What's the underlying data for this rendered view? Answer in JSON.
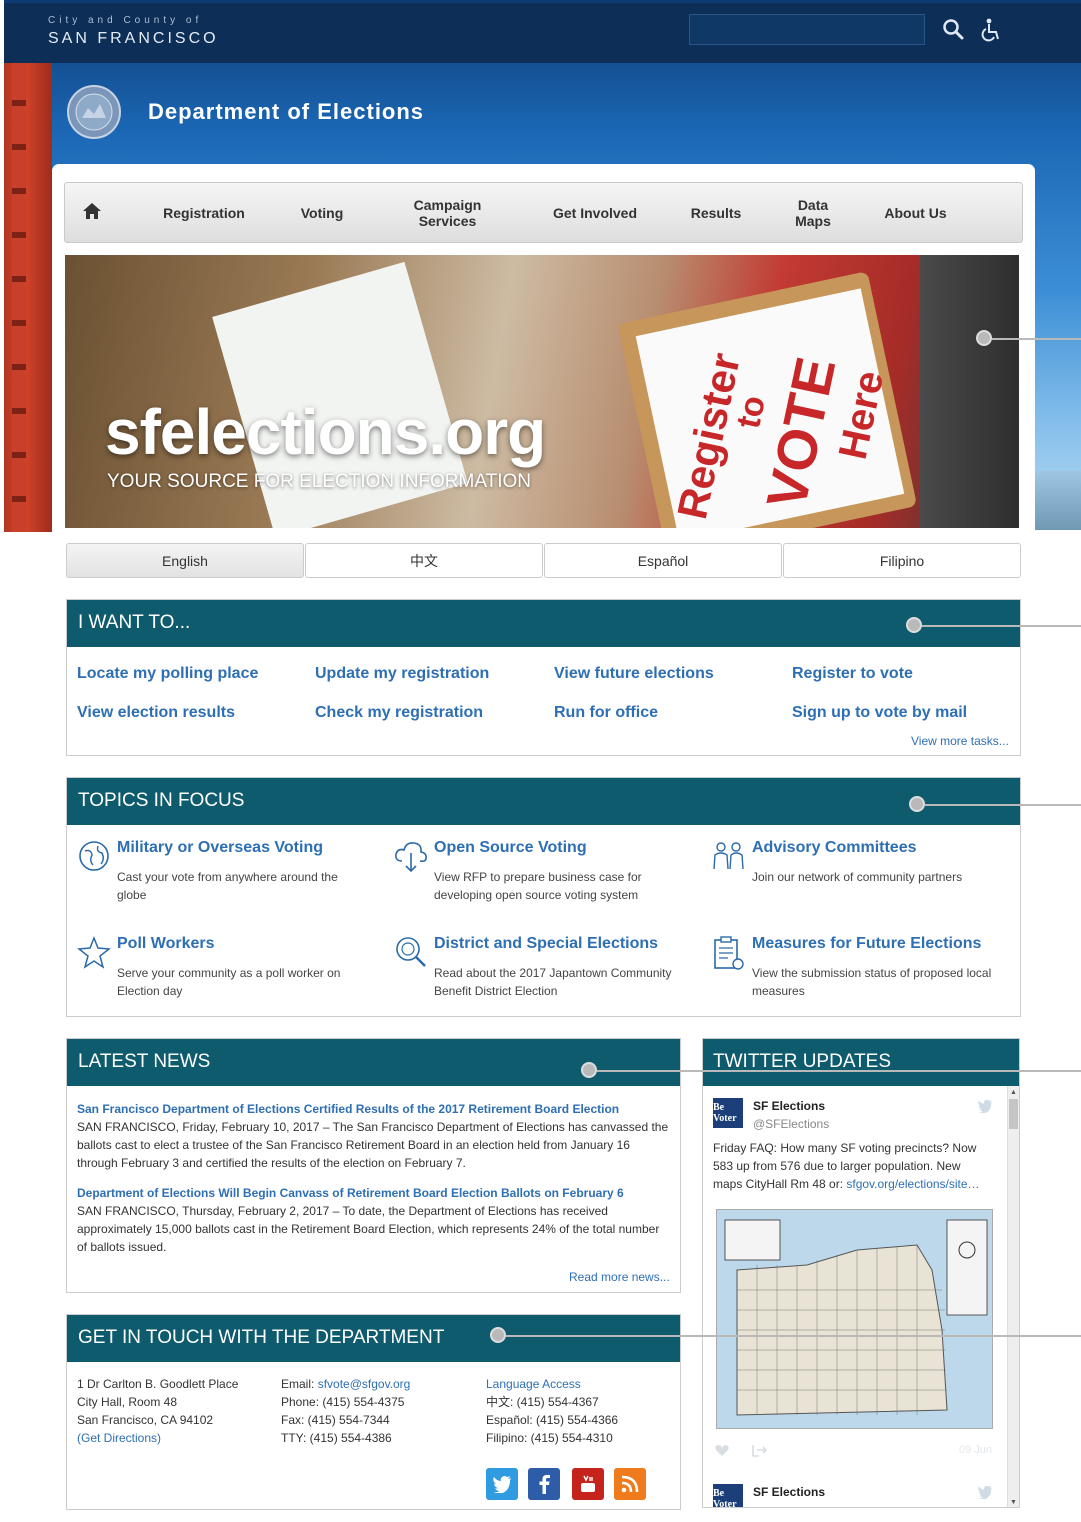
{
  "header": {
    "brand_small": "City and County of",
    "brand_big": "SAN FRANCISCO",
    "search_placeholder": "",
    "department_title": "Department of Elections"
  },
  "nav": {
    "items": [
      {
        "label": "Registration"
      },
      {
        "label": "Voting"
      },
      {
        "label": "Campaign Services"
      },
      {
        "label": "Get Involved"
      },
      {
        "label": "Results"
      },
      {
        "label": "Data Maps"
      },
      {
        "label": "About Us"
      }
    ]
  },
  "hero": {
    "brand": "sfelections.org",
    "tagline": "YOUR SOURCE FOR ELECTION INFORMATION",
    "sign_line1": "Register",
    "sign_line2": "to",
    "sign_line3": "VOTE",
    "sign_line4": "Here"
  },
  "languages": [
    "English",
    "中文",
    "Español",
    "Filipino"
  ],
  "i_want_to": {
    "title": "I WANT TO...",
    "tasks": [
      "Locate my polling place",
      "Update my registration",
      "View future elections",
      "Register to vote",
      "View election results",
      "Check my registration",
      "Run for office",
      "Sign up to vote by mail"
    ],
    "more": "View more tasks..."
  },
  "topics": {
    "title": "TOPICS IN FOCUS",
    "items": [
      {
        "title": "Military or Overseas Voting",
        "desc": "Cast your vote from anywhere around the globe",
        "icon": "globe-icon"
      },
      {
        "title": "Open Source Voting",
        "desc": "View RFP to prepare business case for developing open source voting system",
        "icon": "cloud-download-icon"
      },
      {
        "title": "Advisory Committees",
        "desc": "Join our network of community partners",
        "icon": "people-icon"
      },
      {
        "title": "Poll Workers",
        "desc": "Serve your community as a poll worker on Election day",
        "icon": "star-person-icon"
      },
      {
        "title": "District and Special Elections",
        "desc": "Read about the 2017 Japantown Community Benefit District Election",
        "icon": "map-search-icon"
      },
      {
        "title": "Measures for Future Elections",
        "desc": "View the submission status of proposed local measures",
        "icon": "clipboard-icon"
      }
    ]
  },
  "news": {
    "title": "LATEST NEWS",
    "items": [
      {
        "headline": "San Francisco Department of Elections Certified Results of the 2017 Retirement Board Election",
        "body": "SAN FRANCISCO, Friday, February 10, 2017 – The San Francisco Department of Elections has canvassed the ballots cast to elect a trustee of the San Francisco Retirement Board in an election held from January 16 through February 3 and certified the results of the election on February 7."
      },
      {
        "headline": "Department of Elections Will Begin Canvass of Retirement Board Election Ballots on February 6",
        "body": "SAN FRANCISCO, Thursday, February 2, 2017 – To date, the Department of Elections has received approximately 15,000 ballots cast in the Retirement Board Election, which represents 24% of the total number of ballots issued."
      }
    ],
    "more": "Read more news..."
  },
  "contact": {
    "title": "GET IN TOUCH WITH THE DEPARTMENT",
    "address": [
      "1 Dr Carlton B. Goodlett Place",
      "City Hall, Room 48",
      "San Francisco, CA 94102"
    ],
    "directions": "(Get Directions)",
    "email_label": "Email: ",
    "email": "sfvote@sfgov.org",
    "phone": "Phone: (415) 554-4375",
    "fax": "Fax: (415) 554-7344",
    "tty": "TTY: (415) 554-4386",
    "language_access": "Language Access",
    "chinese": "中文: (415) 554-4367",
    "spanish": "Español: (415) 554-4366",
    "filipino": "Filipino: (415) 554-4310",
    "social": [
      {
        "name": "twitter",
        "color": "#2f9be0"
      },
      {
        "name": "facebook",
        "color": "#2d5da8"
      },
      {
        "name": "youtube",
        "color": "#c7231d"
      },
      {
        "name": "rss",
        "color": "#f07b1c"
      }
    ]
  },
  "twitter": {
    "title": "TWITTER UPDATES",
    "avatar_text": "Be Voter",
    "tweets": [
      {
        "name": "SF Elections",
        "handle": "@SFElections",
        "text": "Friday FAQ: How many SF voting precincts? Now 583 up from 576 due to larger population. New maps CityHall Rm 48 or: ",
        "link": "sfgov.org/elections/site…",
        "date": "09 Jun"
      },
      {
        "name": "SF Elections"
      }
    ]
  },
  "colors": {
    "header_bg": "#0c2e57",
    "section_bar": "#0f5b6e",
    "link": "#2e6fb4"
  }
}
